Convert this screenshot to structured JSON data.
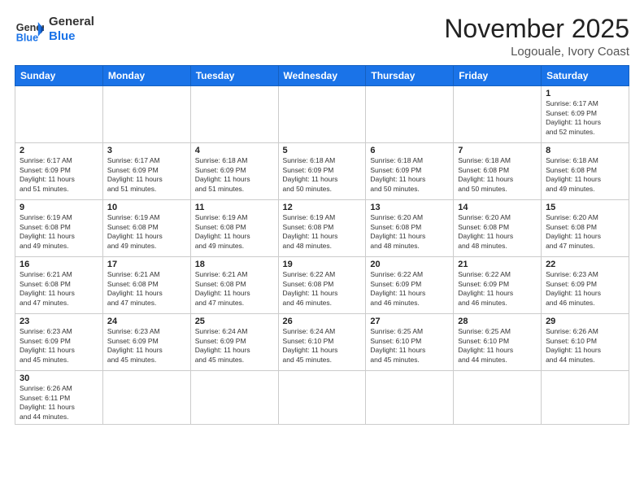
{
  "header": {
    "logo_general": "General",
    "logo_blue": "Blue",
    "month_title": "November 2025",
    "location": "Logouale, Ivory Coast"
  },
  "days_of_week": [
    "Sunday",
    "Monday",
    "Tuesday",
    "Wednesday",
    "Thursday",
    "Friday",
    "Saturday"
  ],
  "weeks": [
    [
      {
        "day": "",
        "info": ""
      },
      {
        "day": "",
        "info": ""
      },
      {
        "day": "",
        "info": ""
      },
      {
        "day": "",
        "info": ""
      },
      {
        "day": "",
        "info": ""
      },
      {
        "day": "",
        "info": ""
      },
      {
        "day": "1",
        "info": "Sunrise: 6:17 AM\nSunset: 6:09 PM\nDaylight: 11 hours\nand 52 minutes."
      }
    ],
    [
      {
        "day": "2",
        "info": "Sunrise: 6:17 AM\nSunset: 6:09 PM\nDaylight: 11 hours\nand 51 minutes."
      },
      {
        "day": "3",
        "info": "Sunrise: 6:17 AM\nSunset: 6:09 PM\nDaylight: 11 hours\nand 51 minutes."
      },
      {
        "day": "4",
        "info": "Sunrise: 6:18 AM\nSunset: 6:09 PM\nDaylight: 11 hours\nand 51 minutes."
      },
      {
        "day": "5",
        "info": "Sunrise: 6:18 AM\nSunset: 6:09 PM\nDaylight: 11 hours\nand 50 minutes."
      },
      {
        "day": "6",
        "info": "Sunrise: 6:18 AM\nSunset: 6:09 PM\nDaylight: 11 hours\nand 50 minutes."
      },
      {
        "day": "7",
        "info": "Sunrise: 6:18 AM\nSunset: 6:08 PM\nDaylight: 11 hours\nand 50 minutes."
      },
      {
        "day": "8",
        "info": "Sunrise: 6:18 AM\nSunset: 6:08 PM\nDaylight: 11 hours\nand 49 minutes."
      }
    ],
    [
      {
        "day": "9",
        "info": "Sunrise: 6:19 AM\nSunset: 6:08 PM\nDaylight: 11 hours\nand 49 minutes."
      },
      {
        "day": "10",
        "info": "Sunrise: 6:19 AM\nSunset: 6:08 PM\nDaylight: 11 hours\nand 49 minutes."
      },
      {
        "day": "11",
        "info": "Sunrise: 6:19 AM\nSunset: 6:08 PM\nDaylight: 11 hours\nand 49 minutes."
      },
      {
        "day": "12",
        "info": "Sunrise: 6:19 AM\nSunset: 6:08 PM\nDaylight: 11 hours\nand 48 minutes."
      },
      {
        "day": "13",
        "info": "Sunrise: 6:20 AM\nSunset: 6:08 PM\nDaylight: 11 hours\nand 48 minutes."
      },
      {
        "day": "14",
        "info": "Sunrise: 6:20 AM\nSunset: 6:08 PM\nDaylight: 11 hours\nand 48 minutes."
      },
      {
        "day": "15",
        "info": "Sunrise: 6:20 AM\nSunset: 6:08 PM\nDaylight: 11 hours\nand 47 minutes."
      }
    ],
    [
      {
        "day": "16",
        "info": "Sunrise: 6:21 AM\nSunset: 6:08 PM\nDaylight: 11 hours\nand 47 minutes."
      },
      {
        "day": "17",
        "info": "Sunrise: 6:21 AM\nSunset: 6:08 PM\nDaylight: 11 hours\nand 47 minutes."
      },
      {
        "day": "18",
        "info": "Sunrise: 6:21 AM\nSunset: 6:08 PM\nDaylight: 11 hours\nand 47 minutes."
      },
      {
        "day": "19",
        "info": "Sunrise: 6:22 AM\nSunset: 6:08 PM\nDaylight: 11 hours\nand 46 minutes."
      },
      {
        "day": "20",
        "info": "Sunrise: 6:22 AM\nSunset: 6:09 PM\nDaylight: 11 hours\nand 46 minutes."
      },
      {
        "day": "21",
        "info": "Sunrise: 6:22 AM\nSunset: 6:09 PM\nDaylight: 11 hours\nand 46 minutes."
      },
      {
        "day": "22",
        "info": "Sunrise: 6:23 AM\nSunset: 6:09 PM\nDaylight: 11 hours\nand 46 minutes."
      }
    ],
    [
      {
        "day": "23",
        "info": "Sunrise: 6:23 AM\nSunset: 6:09 PM\nDaylight: 11 hours\nand 45 minutes."
      },
      {
        "day": "24",
        "info": "Sunrise: 6:23 AM\nSunset: 6:09 PM\nDaylight: 11 hours\nand 45 minutes."
      },
      {
        "day": "25",
        "info": "Sunrise: 6:24 AM\nSunset: 6:09 PM\nDaylight: 11 hours\nand 45 minutes."
      },
      {
        "day": "26",
        "info": "Sunrise: 6:24 AM\nSunset: 6:10 PM\nDaylight: 11 hours\nand 45 minutes."
      },
      {
        "day": "27",
        "info": "Sunrise: 6:25 AM\nSunset: 6:10 PM\nDaylight: 11 hours\nand 45 minutes."
      },
      {
        "day": "28",
        "info": "Sunrise: 6:25 AM\nSunset: 6:10 PM\nDaylight: 11 hours\nand 44 minutes."
      },
      {
        "day": "29",
        "info": "Sunrise: 6:26 AM\nSunset: 6:10 PM\nDaylight: 11 hours\nand 44 minutes."
      }
    ],
    [
      {
        "day": "30",
        "info": "Sunrise: 6:26 AM\nSunset: 6:11 PM\nDaylight: 11 hours\nand 44 minutes."
      },
      {
        "day": "",
        "info": ""
      },
      {
        "day": "",
        "info": ""
      },
      {
        "day": "",
        "info": ""
      },
      {
        "day": "",
        "info": ""
      },
      {
        "day": "",
        "info": ""
      },
      {
        "day": "",
        "info": ""
      }
    ]
  ]
}
